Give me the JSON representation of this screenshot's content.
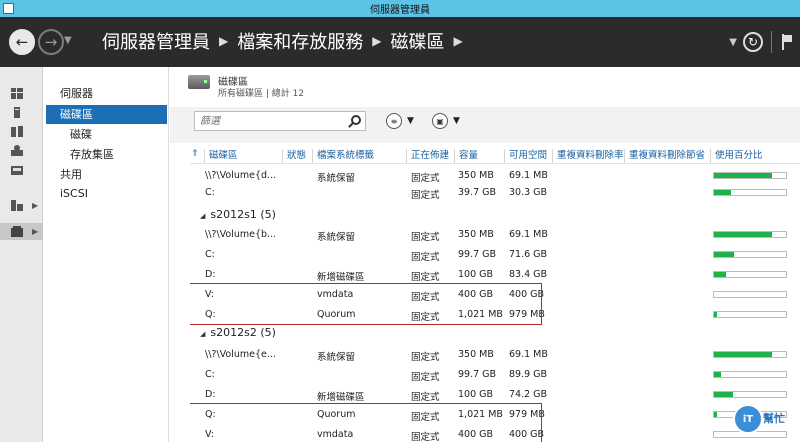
{
  "window": {
    "title": "伺服器管理員"
  },
  "nav": {
    "breadcrumb": [
      "伺服器管理員",
      "檔案和存放服務",
      "磁碟區"
    ]
  },
  "sidebar": {
    "items": [
      {
        "label": "伺服器",
        "active": false,
        "child": false
      },
      {
        "label": "磁碟區",
        "active": true,
        "child": false
      },
      {
        "label": "磁碟",
        "active": false,
        "child": true
      },
      {
        "label": "存放集區",
        "active": false,
        "child": true
      },
      {
        "label": "共用",
        "active": false,
        "child": false
      },
      {
        "label": "iSCSI",
        "active": false,
        "child": false
      }
    ]
  },
  "section": {
    "title": "磁碟區",
    "subtitle": "所有磁碟區 | 總計 12"
  },
  "toolbar": {
    "filter_placeholder": "篩選"
  },
  "table": {
    "columns": [
      "磁碟區",
      "狀態",
      "檔案系統標籤",
      "正在佈建",
      "容量",
      "可用空間",
      "重複資料刪除率",
      "重複資料刪除節省",
      "使用百分比"
    ],
    "rows": [
      {
        "kind": "item",
        "volume": "\\\\?\\Volume{d...",
        "status": "",
        "label": "系統保留",
        "prov": "固定式",
        "capacity": "350 MB",
        "free": "69.1 MB",
        "usage": 0.8
      },
      {
        "kind": "item",
        "volume": "C:",
        "status": "",
        "label": "",
        "prov": "固定式",
        "capacity": "39.7 GB",
        "free": "30.3 GB",
        "usage": 0.24
      },
      {
        "kind": "group",
        "label": "s2012s1 (5)"
      },
      {
        "kind": "item",
        "volume": "\\\\?\\Volume{b...",
        "status": "",
        "label": "系統保留",
        "prov": "固定式",
        "capacity": "350 MB",
        "free": "69.1 MB",
        "usage": 0.8
      },
      {
        "kind": "item",
        "volume": "C:",
        "status": "",
        "label": "",
        "prov": "固定式",
        "capacity": "99.7 GB",
        "free": "71.6 GB",
        "usage": 0.28
      },
      {
        "kind": "item",
        "volume": "D:",
        "status": "",
        "label": "新增磁碟區",
        "prov": "固定式",
        "capacity": "100 GB",
        "free": "83.4 GB",
        "usage": 0.17
      },
      {
        "kind": "item",
        "volume": "V:",
        "status": "",
        "label": "vmdata",
        "prov": "固定式",
        "capacity": "400 GB",
        "free": "400 GB",
        "usage": 0.0
      },
      {
        "kind": "item",
        "volume": "Q:",
        "status": "",
        "label": "Quorum",
        "prov": "固定式",
        "capacity": "1,021 MB",
        "free": "979 MB",
        "usage": 0.04
      },
      {
        "kind": "group",
        "label": "s2012s2 (5)"
      },
      {
        "kind": "item",
        "volume": "\\\\?\\Volume{e...",
        "status": "",
        "label": "系統保留",
        "prov": "固定式",
        "capacity": "350 MB",
        "free": "69.1 MB",
        "usage": 0.8
      },
      {
        "kind": "item",
        "volume": "C:",
        "status": "",
        "label": "",
        "prov": "固定式",
        "capacity": "99.7 GB",
        "free": "89.9 GB",
        "usage": 0.1
      },
      {
        "kind": "item",
        "volume": "D:",
        "status": "",
        "label": "新增磁碟區",
        "prov": "固定式",
        "capacity": "100 GB",
        "free": "74.2 GB",
        "usage": 0.26
      },
      {
        "kind": "item",
        "volume": "Q:",
        "status": "",
        "label": "Quorum",
        "prov": "固定式",
        "capacity": "1,021 MB",
        "free": "979 MB",
        "usage": 0.04
      },
      {
        "kind": "item",
        "volume": "V:",
        "status": "",
        "label": "vmdata",
        "prov": "固定式",
        "capacity": "400 GB",
        "free": "400 GB",
        "usage": 0.0
      }
    ]
  },
  "watermark": {
    "badge": "iT",
    "text": "幫忙"
  },
  "colors": {
    "usage_bar": "#1fb14a",
    "highlight": "#b22a2a",
    "selected": "#1c6fb5",
    "titlebar": "#5bc3e6"
  }
}
